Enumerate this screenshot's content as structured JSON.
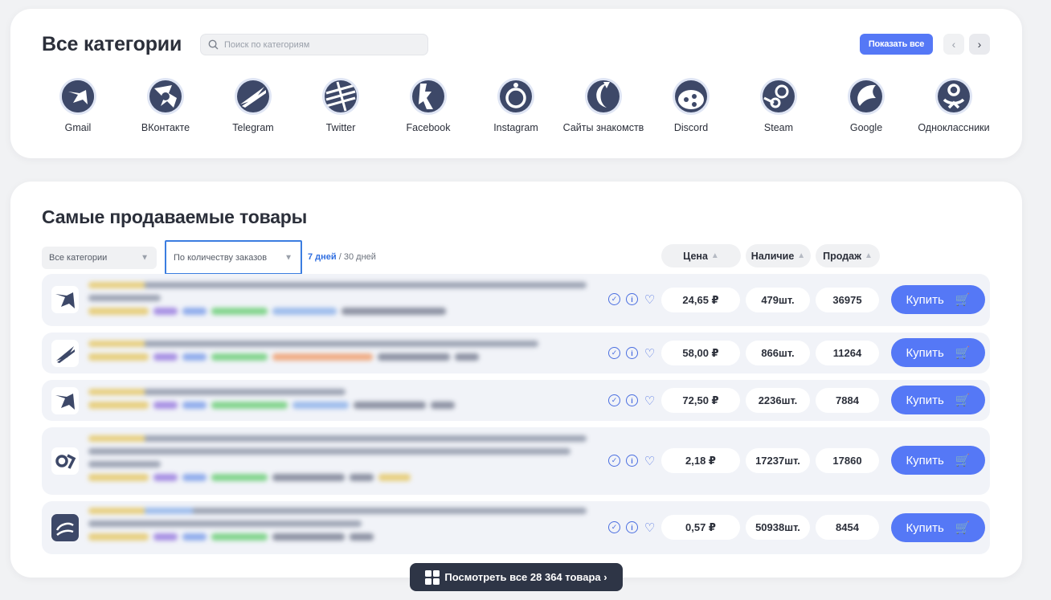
{
  "categories": {
    "title": "Все категории",
    "search_placeholder": "Поиск по категориям",
    "show_all_label": "Показать все",
    "prev_icon": "‹",
    "next_icon": "›",
    "items": [
      {
        "label": "Gmail",
        "icon": "gmail-icon"
      },
      {
        "label": "ВКонтакте",
        "icon": "vk-icon"
      },
      {
        "label": "Telegram",
        "icon": "telegram-icon"
      },
      {
        "label": "Twitter",
        "icon": "twitter-icon"
      },
      {
        "label": "Facebook",
        "icon": "facebook-icon"
      },
      {
        "label": "Instagram",
        "icon": "instagram-icon"
      },
      {
        "label": "Сайты знакомств",
        "icon": "dating-icon"
      },
      {
        "label": "Discord",
        "icon": "discord-icon"
      },
      {
        "label": "Steam",
        "icon": "steam-icon"
      },
      {
        "label": "Google",
        "icon": "google-icon"
      },
      {
        "label": "Одноклассники",
        "icon": "ok-icon"
      }
    ]
  },
  "products": {
    "title": "Самые продаваемые товары",
    "filter_category": "Все категории",
    "filter_sort": "По количеству заказов",
    "period_active": "7 дней",
    "period_sep": " / ",
    "period_other": "30 дней",
    "head_price": "Цена",
    "head_stock": "Наличие",
    "head_sales": "Продаж",
    "buy_label": "Купить",
    "rows": [
      {
        "logo": "gmail",
        "price": "24,65 ₽",
        "stock": "479шт.",
        "sales": "36975"
      },
      {
        "logo": "telegram",
        "price": "58,00 ₽",
        "stock": "866шт.",
        "sales": "11264"
      },
      {
        "logo": "gmail",
        "price": "72,50 ₽",
        "stock": "2236шт.",
        "sales": "7884"
      },
      {
        "logo": "ok",
        "price": "2,18 ₽",
        "stock": "17237шт.",
        "sales": "17860"
      },
      {
        "logo": "rambler",
        "price": "0,57 ₽",
        "stock": "50938шт.",
        "sales": "8454"
      }
    ],
    "view_all_label": "Посмотреть все 28 364 товара ›"
  },
  "colors": {
    "accent": "#5578f6",
    "icon_dark": "#3d4868",
    "icon_ring": "#dfe5f4"
  }
}
